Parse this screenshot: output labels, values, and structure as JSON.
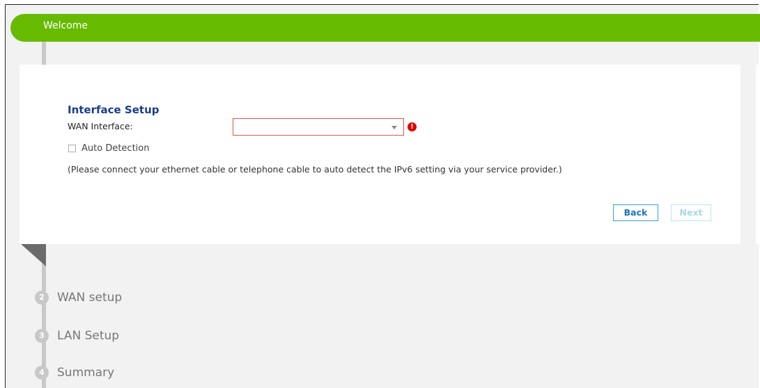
{
  "banner": {
    "title": "Welcome"
  },
  "form": {
    "section_title": "Interface Setup",
    "wan_interface_label": "WAN Interface:",
    "wan_interface_value": "",
    "error_symbol": "!",
    "auto_detection_label": "Auto Detection",
    "auto_detection_checked": false,
    "hint": "(Please connect your ethernet cable or telephone cable to auto detect the IPv6 setting via your service provider.)",
    "back_label": "Back",
    "next_label": "Next"
  },
  "steps": [
    {
      "number": "2",
      "label": "WAN setup"
    },
    {
      "number": "3",
      "label": "LAN Setup"
    },
    {
      "number": "4",
      "label": "Summary"
    }
  ],
  "colors": {
    "banner": "#66bb00",
    "section_title": "#1a3d8f",
    "error": "#e00000",
    "button_border": "#31a0d6"
  }
}
